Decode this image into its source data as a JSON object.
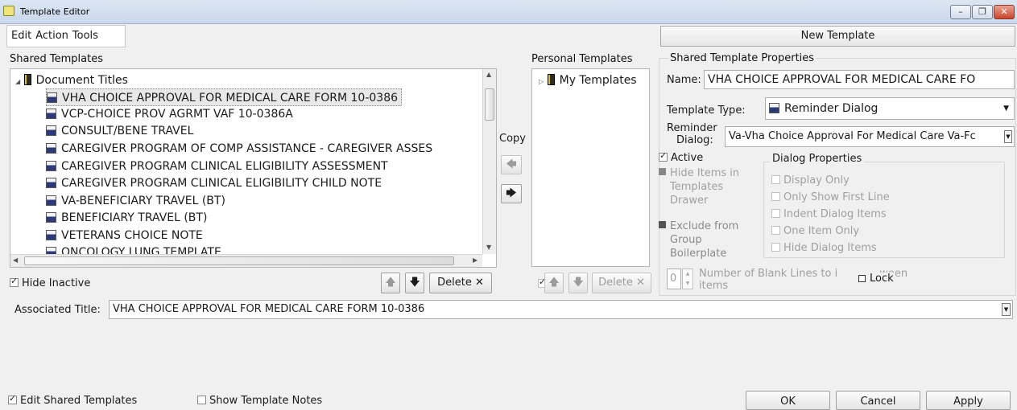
{
  "window": {
    "title": "Template Editor"
  },
  "menu": {
    "items": [
      "Edit",
      "Action",
      "Tools"
    ]
  },
  "new_template_label": "New Template",
  "shared": {
    "label": "Shared Templates",
    "root": "Document Titles",
    "items": [
      "VHA CHOICE APPROVAL FOR MEDICAL CARE FORM 10-0386",
      "VCP-CHOICE PROV AGRMT VAF 10-0386A",
      "CONSULT/BENE TRAVEL",
      "CAREGIVER PROGRAM OF COMP ASSISTANCE - CAREGIVER ASSES",
      "CAREGIVER PROGRAM CLINICAL ELIGIBILITY ASSESSMENT",
      "CAREGIVER PROGRAM CLINICAL ELIGIBILITY CHILD NOTE",
      "VA-BENEFICIARY TRAVEL (BT)",
      "BENEFICIARY TRAVEL (BT)",
      "VETERANS CHOICE NOTE",
      "ONCOLOGY LUNG TEMPLATE"
    ],
    "selected_index": 0,
    "hide_inactive_label": "Hide Inactive",
    "hide_inactive_checked": true,
    "delete_label": "Delete"
  },
  "copy": {
    "label": "Copy"
  },
  "personal": {
    "label": "Personal Templates",
    "root": "My Templates",
    "delete_label": "Delete"
  },
  "properties": {
    "group_label": "Shared Template Properties",
    "name_label": "Name:",
    "name_value": "VHA CHOICE APPROVAL FOR MEDICAL CARE FO",
    "type_label": "Template Type:",
    "type_value": "Reminder Dialog",
    "reminder_label_1": "Reminder",
    "reminder_label_2": "Dialog:",
    "reminder_value": "Va-Vha Choice Approval For Medical Care Va-Fc",
    "active_label": "Active",
    "active_checked": true,
    "hide_items_label": "Hide Items in Templates Drawer",
    "exclude_label": "Exclude from Group Boilerplate",
    "dialog_props_label": "Dialog Properties",
    "dialog_props": [
      "Display Only",
      "Only Show First Line",
      "Indent Dialog Items",
      "One Item Only",
      "Hide Dialog Items"
    ],
    "blank_lines_value": "0",
    "blank_lines_label": "Number of Blank Lines to i",
    "blank_lines_tail": "ween",
    "blank_lines_label2": "items",
    "lock_label": "Lock"
  },
  "associated_title": {
    "label": "Associated Title:",
    "value": "VHA CHOICE APPROVAL FOR MEDICAL CARE FORM 10-0386"
  },
  "footer": {
    "edit_shared_label": "Edit Shared Templates",
    "edit_shared_checked": true,
    "show_notes_label": "Show Template Notes",
    "show_notes_checked": false,
    "ok_label": "OK",
    "cancel_label": "Cancel",
    "apply_label": "Apply"
  }
}
